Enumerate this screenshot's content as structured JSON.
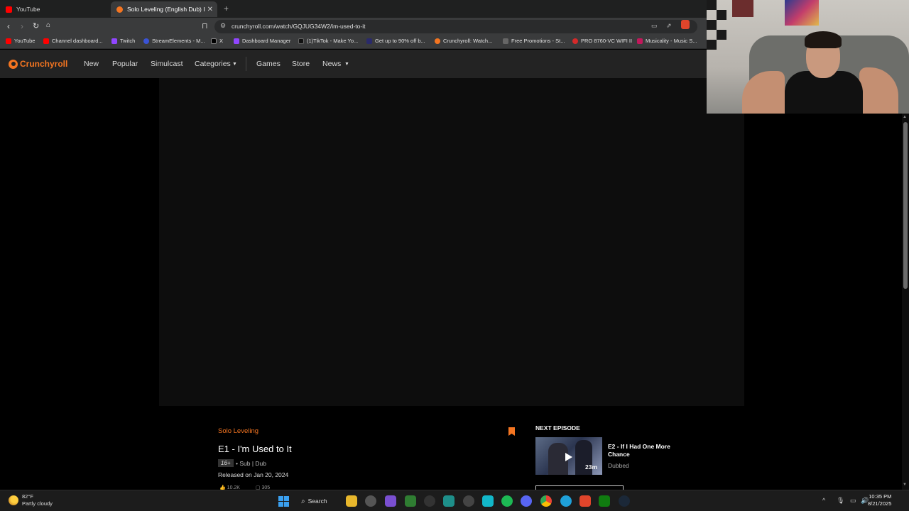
{
  "browser": {
    "tabs": [
      {
        "title": "YouTube",
        "color": "#ff0000"
      },
      {
        "title": "Solo Leveling (English Dub) I'm U",
        "color": "#f47521"
      }
    ],
    "new_tab": "+",
    "url": "crunchyroll.com/watch/GQJUG34W2/im-used-to-it",
    "bookmarks": [
      {
        "label": "YouTube",
        "color": "#ff0000"
      },
      {
        "label": "Channel dashboard...",
        "color": "#ff0000"
      },
      {
        "label": "Twitch",
        "color": "#9146ff"
      },
      {
        "label": "StreamElements - M...",
        "color": "#3a53d6"
      },
      {
        "label": "X",
        "color": "#000000"
      },
      {
        "label": "Dashboard Manager",
        "color": "#9146ff"
      },
      {
        "label": "(1)TikTok - Make Yo...",
        "color": "#111111"
      },
      {
        "label": "Get up to 90% off b...",
        "color": "#2a2a6a"
      },
      {
        "label": "Crunchyroll: Watch...",
        "color": "#f47521"
      },
      {
        "label": "Free Promotions - St...",
        "color": "#666666"
      },
      {
        "label": "PRO 8760-VC WIFI II",
        "color": "#d42a2a"
      },
      {
        "label": "Musicality - Music S...",
        "color": "#c2185b"
      }
    ]
  },
  "crunchyroll": {
    "brand": "Crunchyroll",
    "accent": "#f47521",
    "nav": {
      "new": "New",
      "popular": "Popular",
      "simulcast": "Simulcast",
      "categories": "Categories",
      "games": "Games",
      "store": "Store",
      "news": "News"
    }
  },
  "episode": {
    "series": "Solo Leveling",
    "title": "E1 - I'm Used to It",
    "rating": "16+",
    "audio": "• Sub | Dub",
    "released": "Released on Jan 20, 2024",
    "likes": "10.2K",
    "comments": "305"
  },
  "next_episode": {
    "label": "NEXT EPISODE",
    "title": "E2 - If I Had One More Chance",
    "duration": "23m",
    "status": "Dubbed"
  },
  "taskbar": {
    "weather_temp": "82°F",
    "weather_desc": "Partly cloudy",
    "search": "Search",
    "time": "10:35 PM",
    "date": "8/21/2025"
  }
}
